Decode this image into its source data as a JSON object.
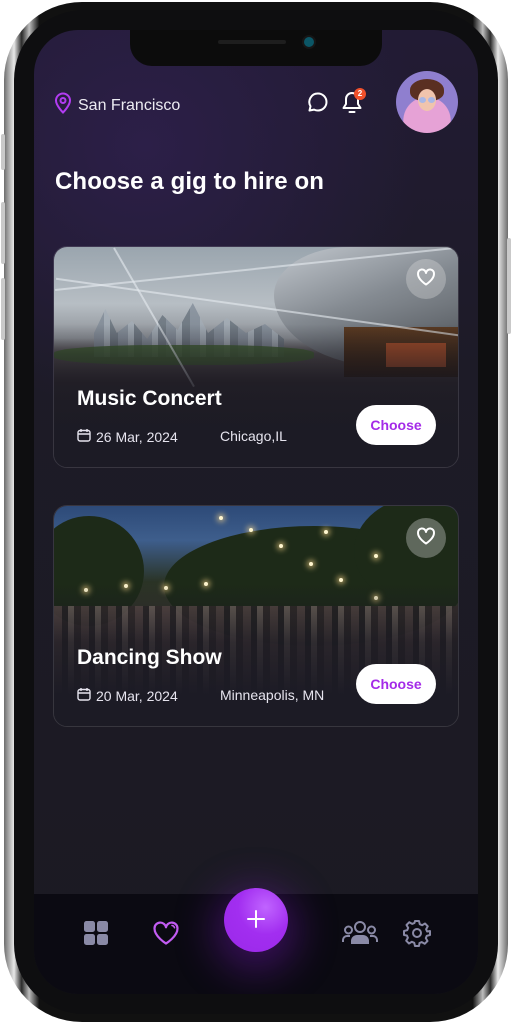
{
  "header": {
    "location": "San Francisco",
    "notification_count": "2",
    "icons": [
      "location-pin-icon",
      "chat-bubble-icon",
      "bell-icon",
      "avatar"
    ]
  },
  "page": {
    "title": "Choose a gig to hire on"
  },
  "gigs": [
    {
      "title": "Music Concert",
      "date": "26 Mar, 2024",
      "location": "Chicago,IL",
      "button": "Choose",
      "image": "outdoor concert pavilion with crowd"
    },
    {
      "title": "Dancing Show",
      "date": "20 Mar, 2024",
      "location": "Minneapolis, MN",
      "button": "Choose",
      "image": "outdoor evening dance under string lights"
    }
  ],
  "nav": {
    "items": [
      "dashboard",
      "favorites",
      "add",
      "community",
      "settings"
    ],
    "active": "favorites"
  },
  "colors": {
    "accent": "#a42ae8",
    "badge": "#f0502b",
    "inactive_icon": "#8a8aa6"
  }
}
